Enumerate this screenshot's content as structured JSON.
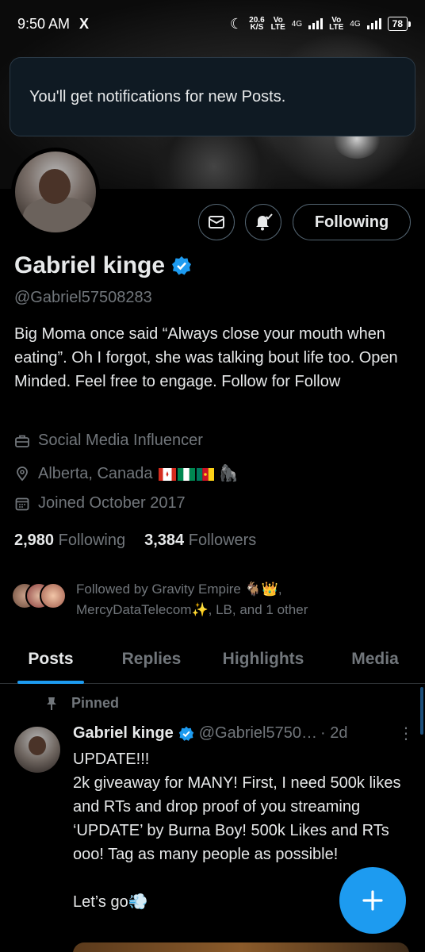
{
  "status_bar": {
    "time": "9:50 AM",
    "x_label": "X",
    "speed_value": "20.6",
    "speed_unit": "K/S",
    "sim1_top": "Vo",
    "sim1_bottom": "LTE",
    "sim1_gen": "4G",
    "sim2_top": "Vo",
    "sim2_bottom": "LTE",
    "sim2_gen": "4G",
    "battery": "78"
  },
  "toast": {
    "message": "You'll get notifications for new Posts."
  },
  "profile": {
    "name": "Gabriel kinge",
    "handle": "@Gabriel57508283",
    "verified": true,
    "bio": "Big Moma once said “Always close your mouth when eating”. Oh I forgot, she was talking bout life too. Open Minded. Feel free to engage. Follow for Follow",
    "category": "Social Media Influencer",
    "location": "Alberta, Canada",
    "location_emoji": "🦍",
    "joined": "Joined October 2017",
    "following_count": "2,980",
    "following_label": "Following",
    "followers_count": "3,384",
    "followers_label": "Followers",
    "followed_by": "Followed by Gravity Empire 🐐👑, MercyDataTelecom✨, LB, and 1 other"
  },
  "actions": {
    "following_button": "Following"
  },
  "tabs": [
    {
      "label": "Posts",
      "active": true
    },
    {
      "label": "Replies",
      "active": false
    },
    {
      "label": "Highlights",
      "active": false
    },
    {
      "label": "Media",
      "active": false
    }
  ],
  "pinned_post": {
    "pinned_label": "Pinned",
    "author": "Gabriel kinge",
    "handle": "@Gabriel5750…",
    "time": "· 2d",
    "more": "⋮",
    "text": "UPDATE!!!\n2k giveaway for MANY! First, I need 500k likes and RTs and drop proof of you streaming ‘UPDATE’ by Burna Boy! 500k Likes and RTs ooo! Tag as many people as possible!\n\nLet’s go💨"
  },
  "colors": {
    "accent": "#1d9bf0",
    "background": "#000000",
    "text_primary": "#e7e9ea",
    "text_secondary": "#71767b",
    "toast_bg": "#0f1a23"
  },
  "icons": {
    "fab": "plus-icon",
    "message": "envelope-icon",
    "notify": "bell-check-icon",
    "verified": "verified-badge-icon",
    "category": "briefcase-icon",
    "location": "location-pin-icon",
    "joined": "calendar-icon",
    "pinned": "pin-icon"
  }
}
